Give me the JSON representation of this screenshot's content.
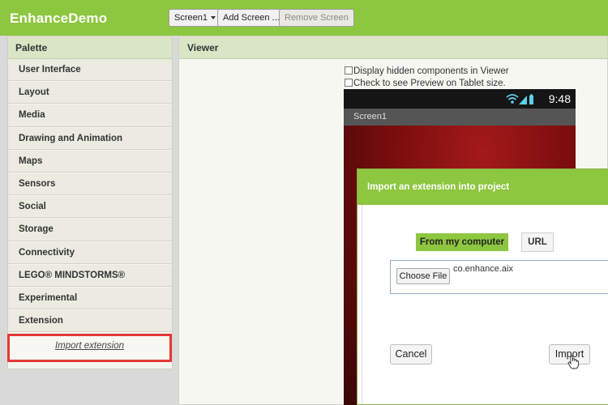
{
  "app": {
    "title": "EnhanceDemo",
    "screen_selector": "Screen1",
    "add_screen_label": "Add Screen ...",
    "remove_screen_label": "Remove Screen"
  },
  "palette": {
    "header": "Palette",
    "items": [
      {
        "label": "User Interface"
      },
      {
        "label": "Layout"
      },
      {
        "label": "Media"
      },
      {
        "label": "Drawing and Animation"
      },
      {
        "label": "Maps"
      },
      {
        "label": "Sensors"
      },
      {
        "label": "Social"
      },
      {
        "label": "Storage"
      },
      {
        "label": "Connectivity"
      },
      {
        "label": "LEGO® MINDSTORMS®"
      },
      {
        "label": "Experimental"
      },
      {
        "label": "Extension"
      }
    ],
    "import_extension_label": "Import extension"
  },
  "viewer": {
    "header": "Viewer",
    "display_hidden_label": "Display hidden components in Viewer",
    "tablet_preview_label": "Check to see Preview on Tablet size."
  },
  "phone": {
    "time": "9:48",
    "screen_title": "Screen1"
  },
  "dialog": {
    "title": "Import an extension into project",
    "from_computer_label": "From my computer",
    "url_label": "URL",
    "choose_file_label": "Choose File",
    "file_name": "co.enhance.aix",
    "cancel_label": "Cancel",
    "import_label": "Import"
  },
  "colors": {
    "accent_green": "#8dc63f",
    "highlight_red": "#e53935"
  }
}
